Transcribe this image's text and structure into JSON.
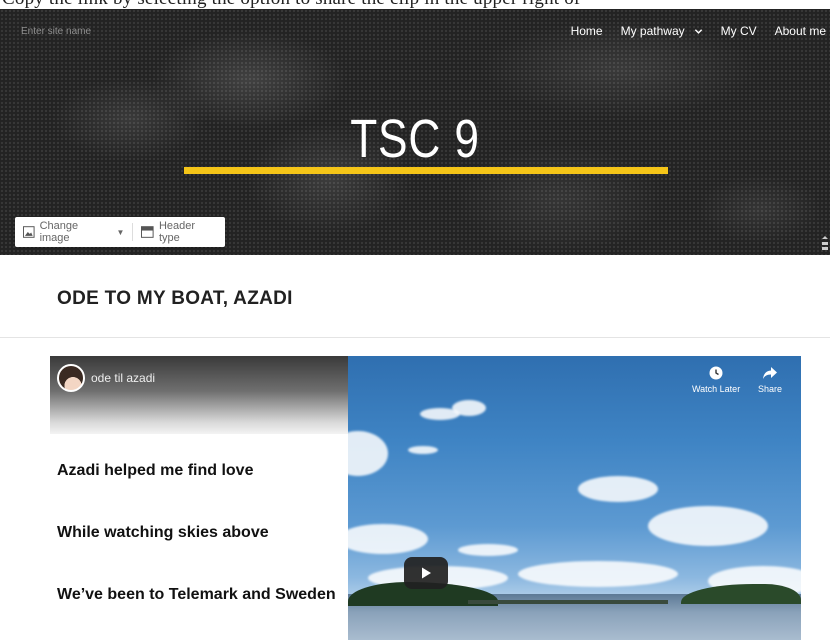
{
  "top_text": "Copy the link by selecting the option to share the clip in the upper right of",
  "header": {
    "site_name_placeholder": "Enter site name",
    "nav": [
      {
        "label": "Home"
      },
      {
        "label": "My pathway"
      },
      {
        "label": "My CV"
      },
      {
        "label": "About me"
      }
    ],
    "title": "TSC 9",
    "accent_color": "#f5c518",
    "toolbar": {
      "change_image_label": "Change image",
      "header_type_label": "Header type"
    }
  },
  "section": {
    "title": "ODE TO MY BOAT, AZADI"
  },
  "video": {
    "title": "ode til azadi",
    "watch_later_label": "Watch Later",
    "share_label": "Share",
    "lyrics": [
      "Azadi helped me find love",
      "While watching skies above",
      "We’ve been to Telemark and Sweden"
    ]
  }
}
